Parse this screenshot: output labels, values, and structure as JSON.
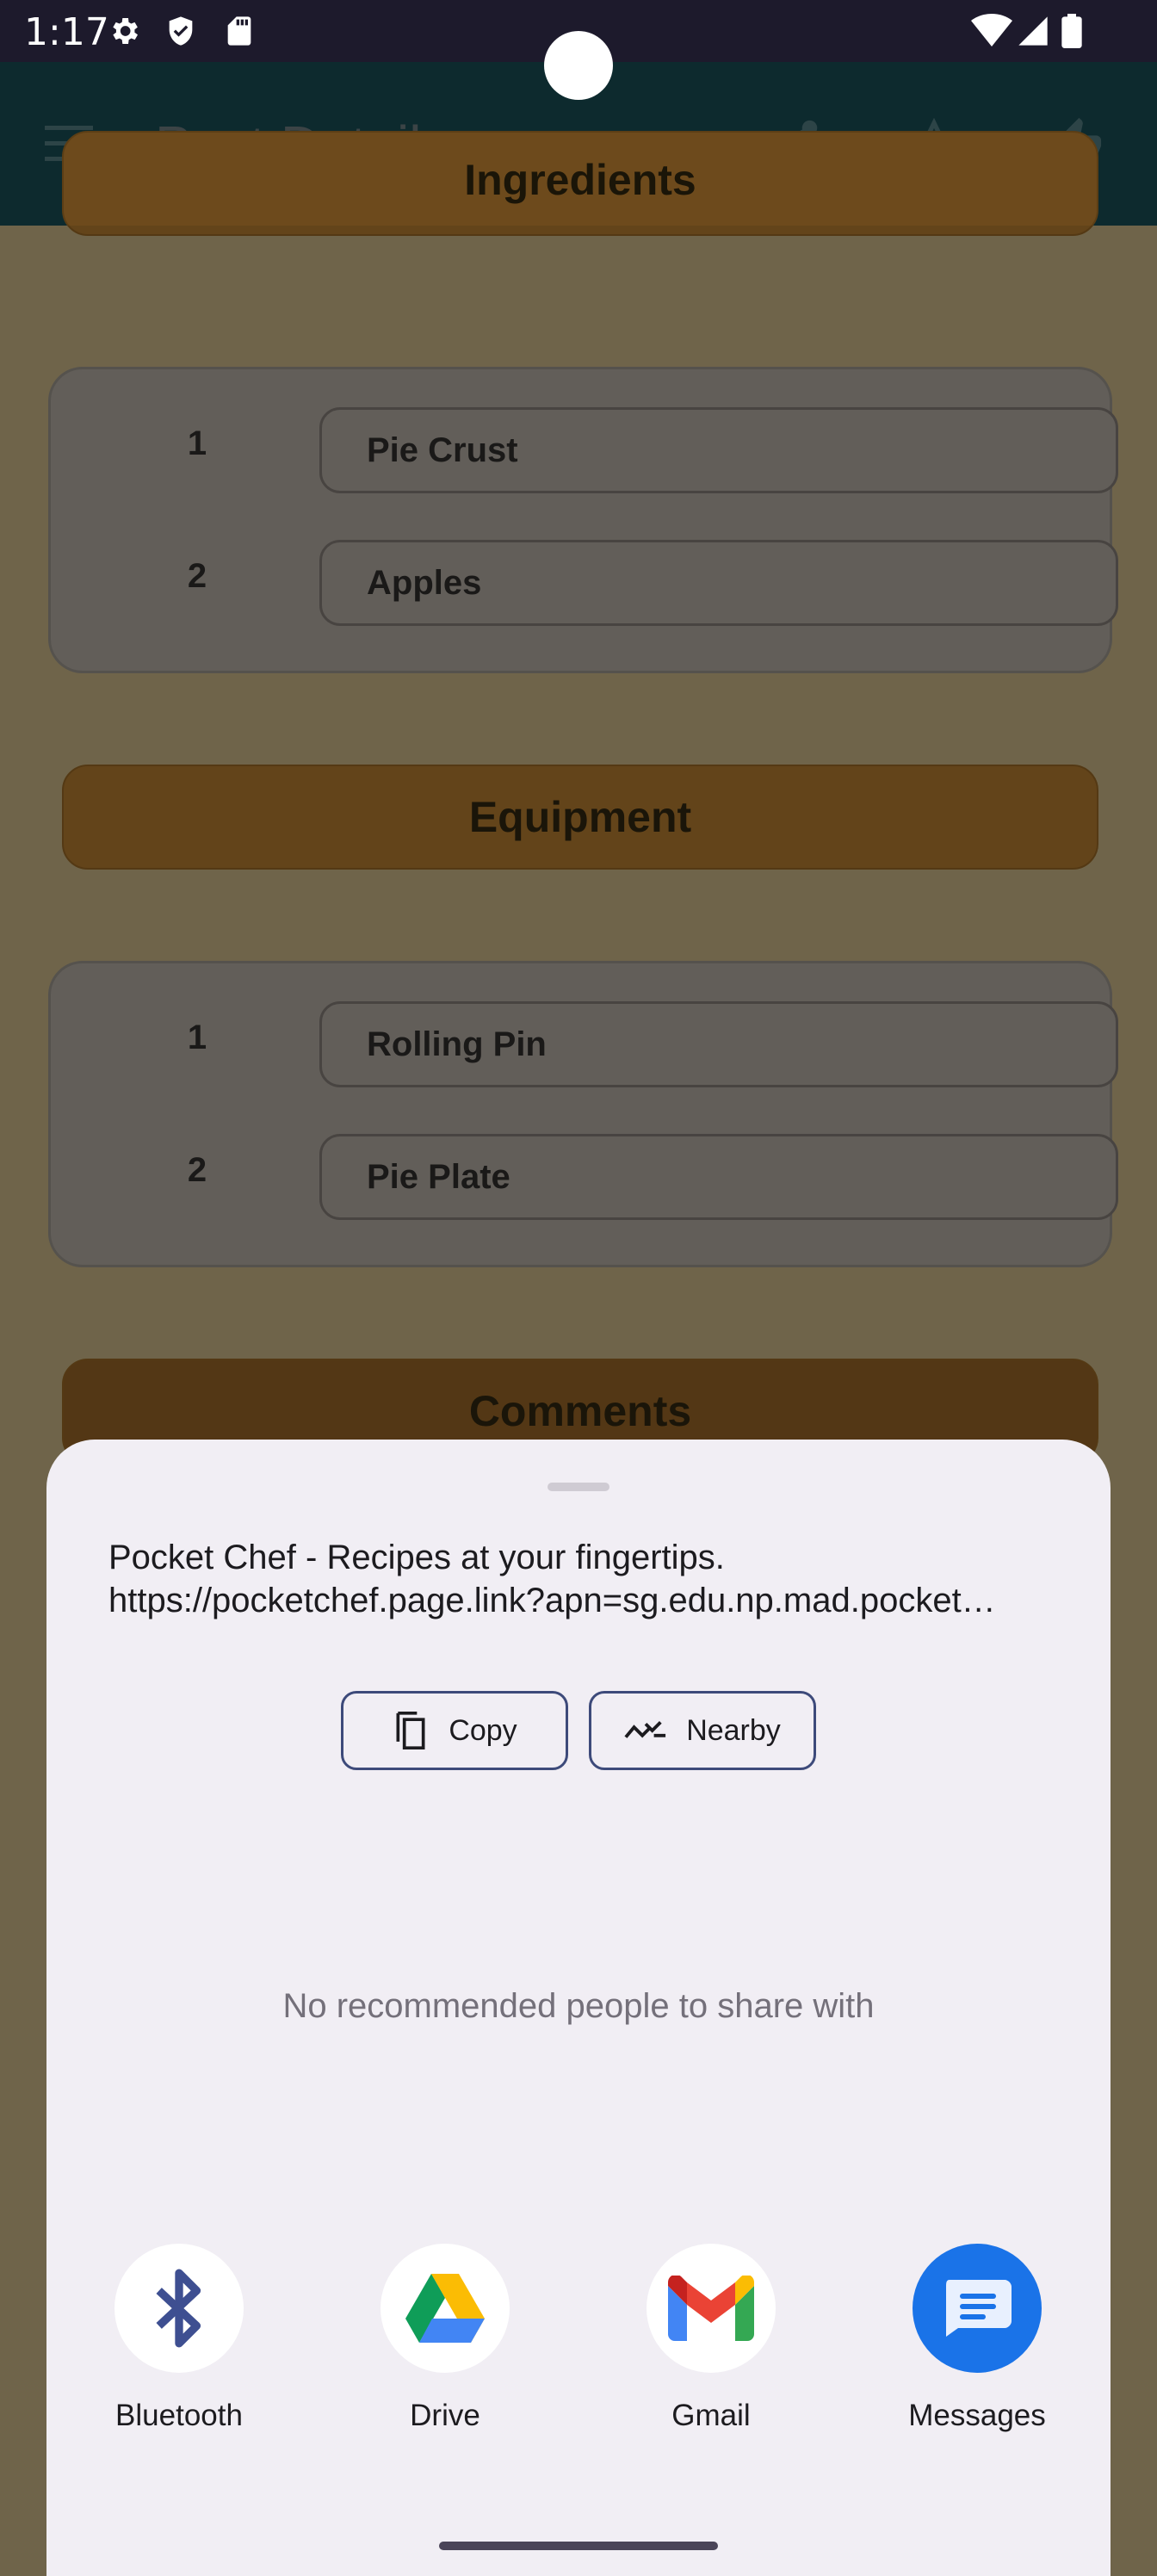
{
  "status_bar": {
    "time": "1:17",
    "icons": [
      "gear-icon",
      "shield-icon",
      "sd-card-icon",
      "wifi-icon",
      "signal-icon",
      "battery-icon"
    ]
  },
  "app_bar": {
    "title": "Post Details",
    "actions": [
      "share-icon",
      "star-icon",
      "thumbs-up-icon"
    ]
  },
  "sections": {
    "ingredients_header": "Ingredients",
    "ingredients": [
      {
        "num": "1",
        "name": "Pie Crust"
      },
      {
        "num": "2",
        "name": "Apples"
      }
    ],
    "equipment_header": "Equipment",
    "equipment": [
      {
        "num": "1",
        "name": "Rolling Pin"
      },
      {
        "num": "2",
        "name": "Pie Plate"
      }
    ],
    "comments_header": "Comments"
  },
  "share_sheet": {
    "text_line1": "Pocket Chef - Recipes at your fingertips.",
    "text_line2": "https://pocketchef.page.link?apn=sg.edu.np.mad.pocket…",
    "copy_label": "Copy",
    "nearby_label": "Nearby",
    "empty_message": "No recommended people to share with",
    "apps": [
      {
        "label": "Bluetooth",
        "icon": "bluetooth-icon"
      },
      {
        "label": "Drive",
        "icon": "google-drive-icon"
      },
      {
        "label": "Gmail",
        "icon": "gmail-icon"
      },
      {
        "label": "Messages",
        "icon": "messages-icon"
      }
    ]
  },
  "colors": {
    "app_bar": "#0d2a2e",
    "section_header": "#6d4a1c",
    "sheet_bg": "#f1eef4",
    "chip_border": "#3d4a7a",
    "messages_blue": "#1a73e8"
  }
}
